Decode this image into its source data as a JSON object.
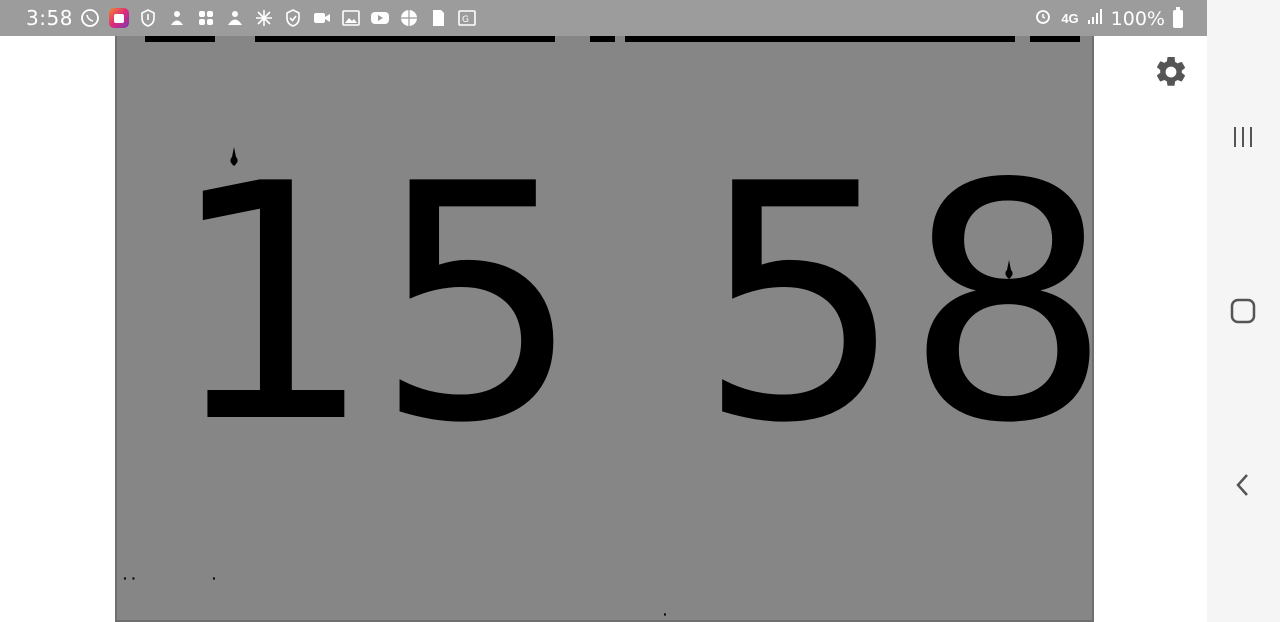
{
  "status_bar": {
    "time": "3:58",
    "icons": [
      "whatsapp-icon",
      "instagram-icon",
      "shield-alert-icon",
      "person-icon",
      "apps-icon",
      "cloud-person-icon",
      "sparkle-icon",
      "shield-check-icon",
      "video-icon",
      "image-icon",
      "youtube-icon",
      "basketball-icon",
      "sd-card-icon",
      "translate-icon"
    ],
    "network": "4G",
    "battery": "100%"
  },
  "clock": {
    "hours": "15",
    "minutes": "58"
  },
  "settings": {
    "icon": "gear-icon"
  },
  "nav": {
    "recents": "recents-icon",
    "home": "home-icon",
    "back": "back-icon"
  },
  "colors": {
    "panel": "#868686",
    "digits": "#000000",
    "status_bar": "#9c9c9c"
  }
}
